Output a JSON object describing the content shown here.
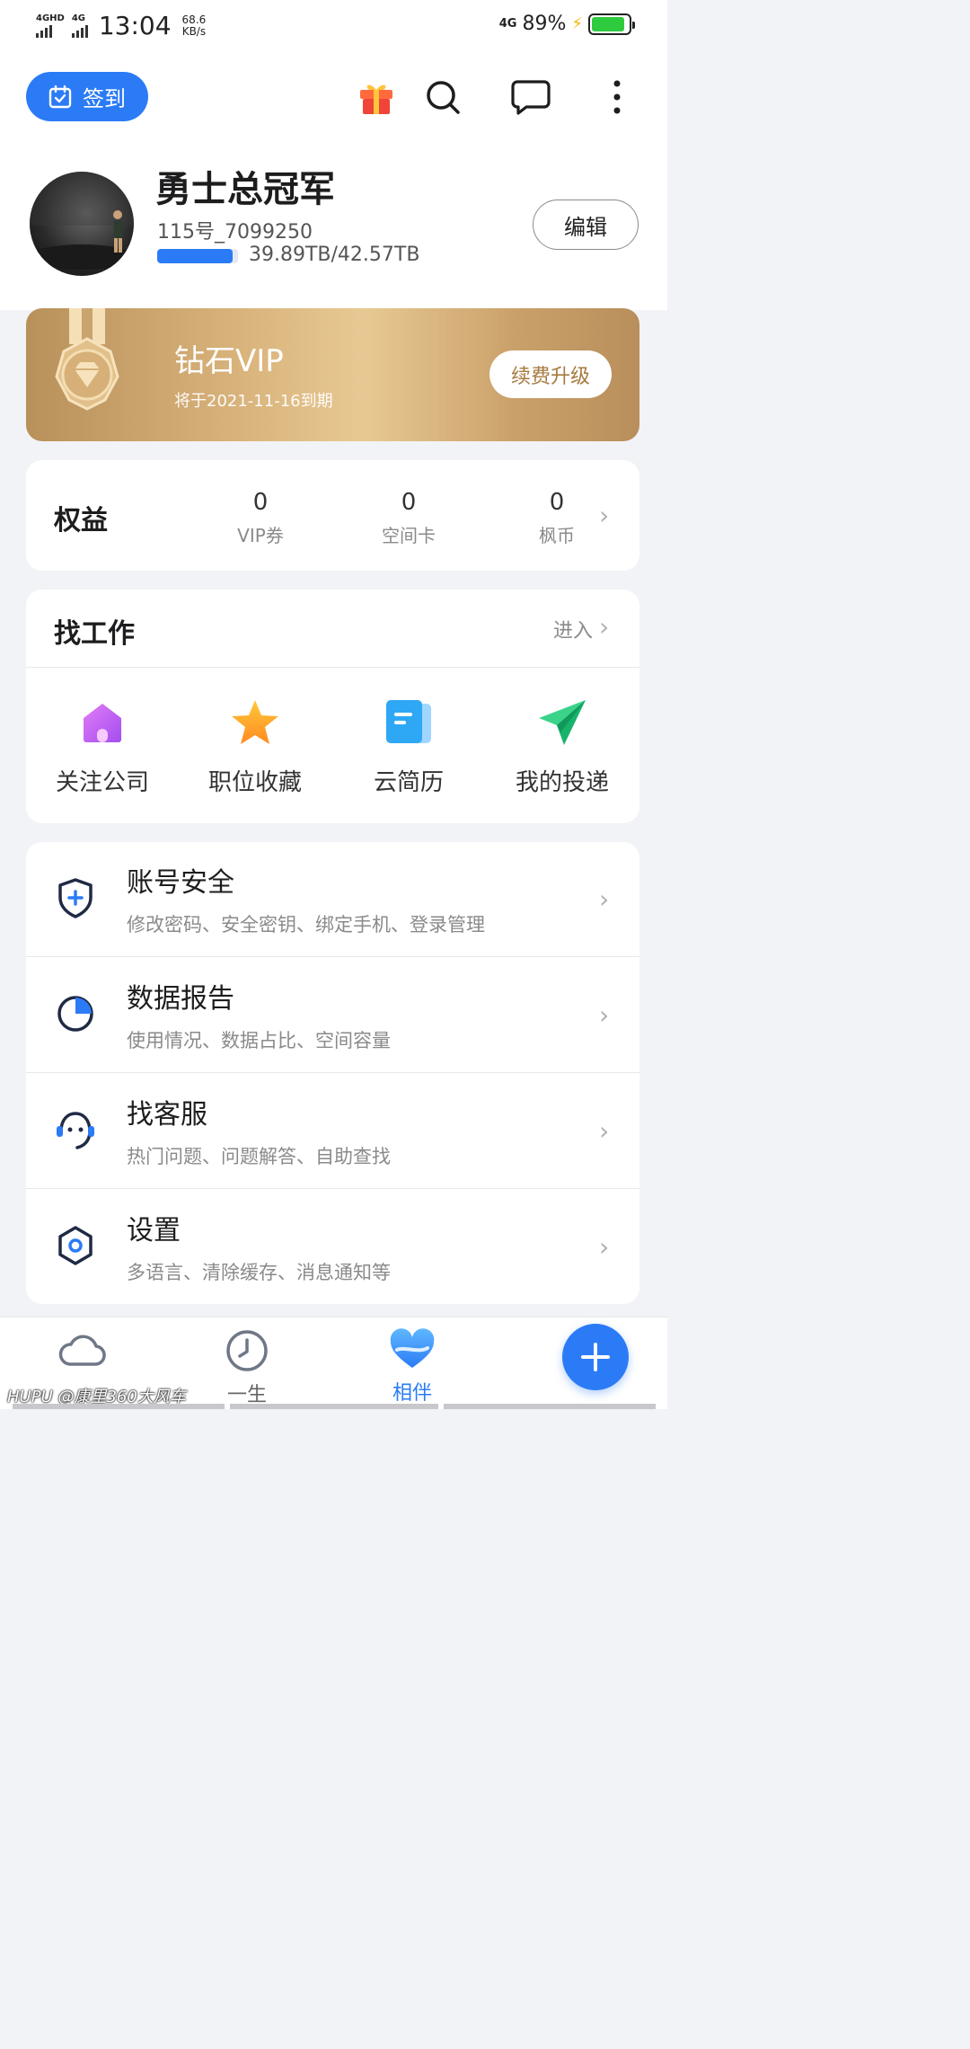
{
  "status_bar": {
    "sig1_label": "4GHD",
    "sig2_label": "4G",
    "time": "13:04",
    "rate_value": "68.6",
    "rate_unit": "KB/s",
    "net_right": "4G",
    "battery_pct": "89%",
    "battery_level": 0.89
  },
  "header": {
    "checkin_label": "签到",
    "icons": [
      "gift-icon",
      "search-icon",
      "message-icon",
      "more-icon"
    ]
  },
  "profile": {
    "name": "勇士总冠军",
    "id": "115号_7099250",
    "storage_text": "39.89TB/42.57TB",
    "storage_used_fraction": 0.937,
    "edit_label": "编辑"
  },
  "vip": {
    "title": "钻石VIP",
    "expire": "将于2021-11-16到期",
    "renew_label": "续费升级"
  },
  "benefits": {
    "title": "权益",
    "items": [
      {
        "value": "0",
        "label": "VIP券"
      },
      {
        "value": "0",
        "label": "空间卡"
      },
      {
        "value": "0",
        "label": "枫币"
      }
    ]
  },
  "jobs": {
    "title": "找工作",
    "enter_label": "进入",
    "items": [
      {
        "label": "关注公司",
        "icon": "company-icon"
      },
      {
        "label": "职位收藏",
        "icon": "star-icon"
      },
      {
        "label": "云简历",
        "icon": "resume-icon"
      },
      {
        "label": "我的投递",
        "icon": "send-icon"
      }
    ]
  },
  "menu": [
    {
      "title": "账号安全",
      "subtitle": "修改密码、安全密钥、绑定手机、登录管理",
      "icon": "shield-icon"
    },
    {
      "title": "数据报告",
      "subtitle": "使用情况、数据占比、空间容量",
      "icon": "pie-chart-icon"
    },
    {
      "title": "找客服",
      "subtitle": "热门问题、问题解答、自助查找",
      "icon": "support-icon"
    },
    {
      "title": "设置",
      "subtitle": "多语言、清除缓存、消息通知等",
      "icon": "settings-icon"
    }
  ],
  "bottom_nav": [
    {
      "label": "",
      "icon": "cloud-icon"
    },
    {
      "label": "一生",
      "icon": "clock-icon"
    },
    {
      "label": "相伴",
      "icon": "heart-icon",
      "active": true
    }
  ],
  "watermark": "HUPU @康里360大风车",
  "colors": {
    "accent": "#2b7bf6",
    "vip_gold": "#d9b37c"
  }
}
